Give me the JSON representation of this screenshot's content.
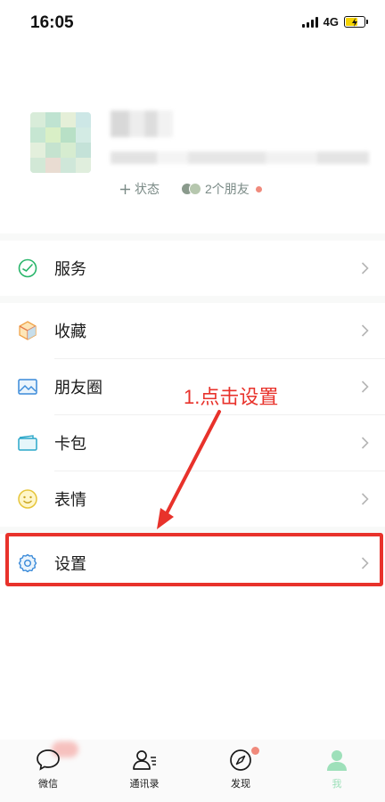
{
  "status_bar": {
    "time": "16:05",
    "network": "4G"
  },
  "profile": {
    "status_label": "状态",
    "friends_label": "2个朋友"
  },
  "menu": {
    "items": [
      {
        "label": "服务",
        "icon": "service-icon"
      },
      {
        "label": "收藏",
        "icon": "favorites-icon"
      },
      {
        "label": "朋友圈",
        "icon": "moments-icon"
      },
      {
        "label": "卡包",
        "icon": "card-wallet-icon"
      },
      {
        "label": "表情",
        "icon": "emoji-icon"
      },
      {
        "label": "设置",
        "icon": "settings-icon"
      }
    ]
  },
  "annotation": {
    "text": "1.点击设置",
    "color": "#e8322b"
  },
  "tabbar": {
    "tabs": [
      {
        "label": "微信",
        "icon": "chat-bubble-icon"
      },
      {
        "label": "通讯录",
        "icon": "contacts-icon"
      },
      {
        "label": "发现",
        "icon": "compass-icon"
      },
      {
        "label": "我",
        "icon": "person-icon",
        "active": true
      }
    ]
  },
  "colors": {
    "accent": "#9ee0ba",
    "annotation_red": "#e8322b",
    "badge": "#f08a7c"
  }
}
